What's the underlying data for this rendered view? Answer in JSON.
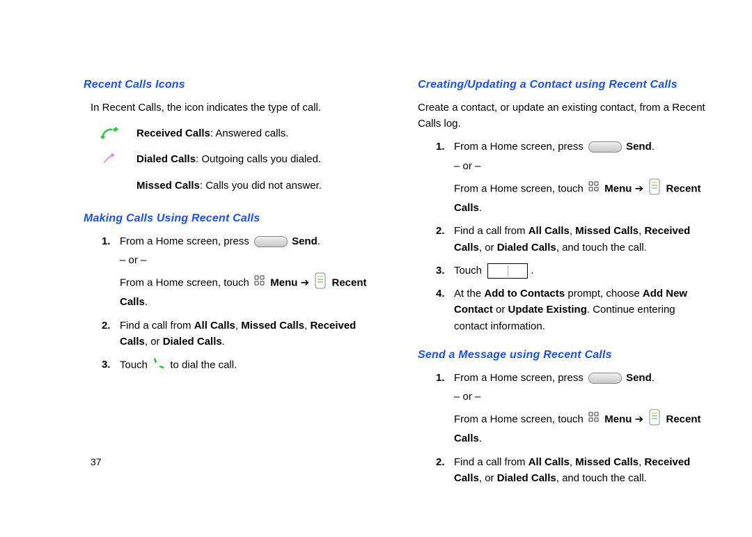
{
  "left": {
    "h1": "Recent Calls Icons",
    "intro": "In Recent Calls, the icon indicates the type of call.",
    "received_label": "Received Calls",
    "received_desc": ": Answered calls.",
    "dialed_label": "Dialed Calls",
    "dialed_desc": ": Outgoing calls you dialed.",
    "missed_label": "Missed Calls",
    "missed_desc": ": Calls you did not answer.",
    "h2": "Making Calls Using Recent Calls",
    "step1a": "From a Home screen, press ",
    "send": "Send",
    "period": ".",
    "or": "– or –",
    "step1b": "From a Home screen, touch ",
    "menu": "Menu",
    "arrow": " ➔ ",
    "recent": "Recent Calls",
    "step2a": "Find a call from ",
    "allcalls": "All Calls",
    "comma": ", ",
    "missedcalls": "Missed Calls",
    "receivedcalls": "Received Calls",
    "or_text": ", or ",
    "dialedcalls": "Dialed Calls",
    "step3a": "Touch ",
    "step3b": " to dial the call."
  },
  "right": {
    "h1": "Creating/Updating a Contact using Recent Calls",
    "intro": "Create a contact, or update an existing contact, from a Recent Calls log.",
    "step1a": "From a Home screen, press ",
    "send": "Send",
    "period": ".",
    "or": "– or –",
    "step1b": "From a Home screen, touch ",
    "menu": "Menu",
    "arrow": " ➔ ",
    "recent": "Recent Calls",
    "step2a": "Find a call from ",
    "allcalls": "All Calls",
    "comma": ", ",
    "missedcalls": "Missed Calls",
    "receivedcalls": "Received Calls",
    "or_text": ", or ",
    "dialedcalls": "Dialed Calls",
    "touchcall": ", and touch the call.",
    "step3": "Touch ",
    "step4a": "At the ",
    "addto": "Add to Contacts",
    "step4b": " prompt, choose ",
    "addnew": "Add New Contact",
    "or_word": " or ",
    "update": "Update Existing",
    "step4c": ". Continue entering contact information.",
    "h2": "Send a Message using Recent Calls"
  },
  "page_number": "37"
}
